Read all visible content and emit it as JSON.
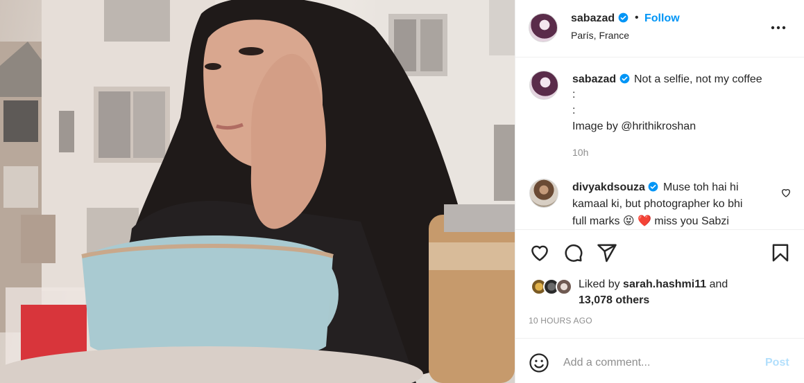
{
  "post": {
    "username": "sabazad",
    "follow_label": "Follow",
    "separator": "•",
    "location": "París, France",
    "more_icon": "more-horizontal-icon",
    "verified_color": "#0095f6"
  },
  "caption": {
    "username": "sabazad",
    "text": "Not a selfie, not my coffee",
    "lines": [
      ":",
      ":",
      "Image by @hrithikroshan"
    ],
    "time": "10h"
  },
  "comment": {
    "username": "divyakdsouza",
    "line1": "Muse toh hai hi",
    "line2": "kamaal ki, but photographer ko bhi",
    "line3": "full marks 😝 ❤️  miss you Sabzi"
  },
  "actions": {
    "icons": [
      "heart-icon",
      "comment-icon",
      "share-icon",
      "bookmark-icon"
    ]
  },
  "likes": {
    "prefix": "Liked by",
    "user": "sarah.hashmi11",
    "conj": "and",
    "others": "13,078 others"
  },
  "posted_ago": "10 HOURS AGO",
  "comment_box": {
    "placeholder": "Add a comment...",
    "post_label": "Post"
  }
}
